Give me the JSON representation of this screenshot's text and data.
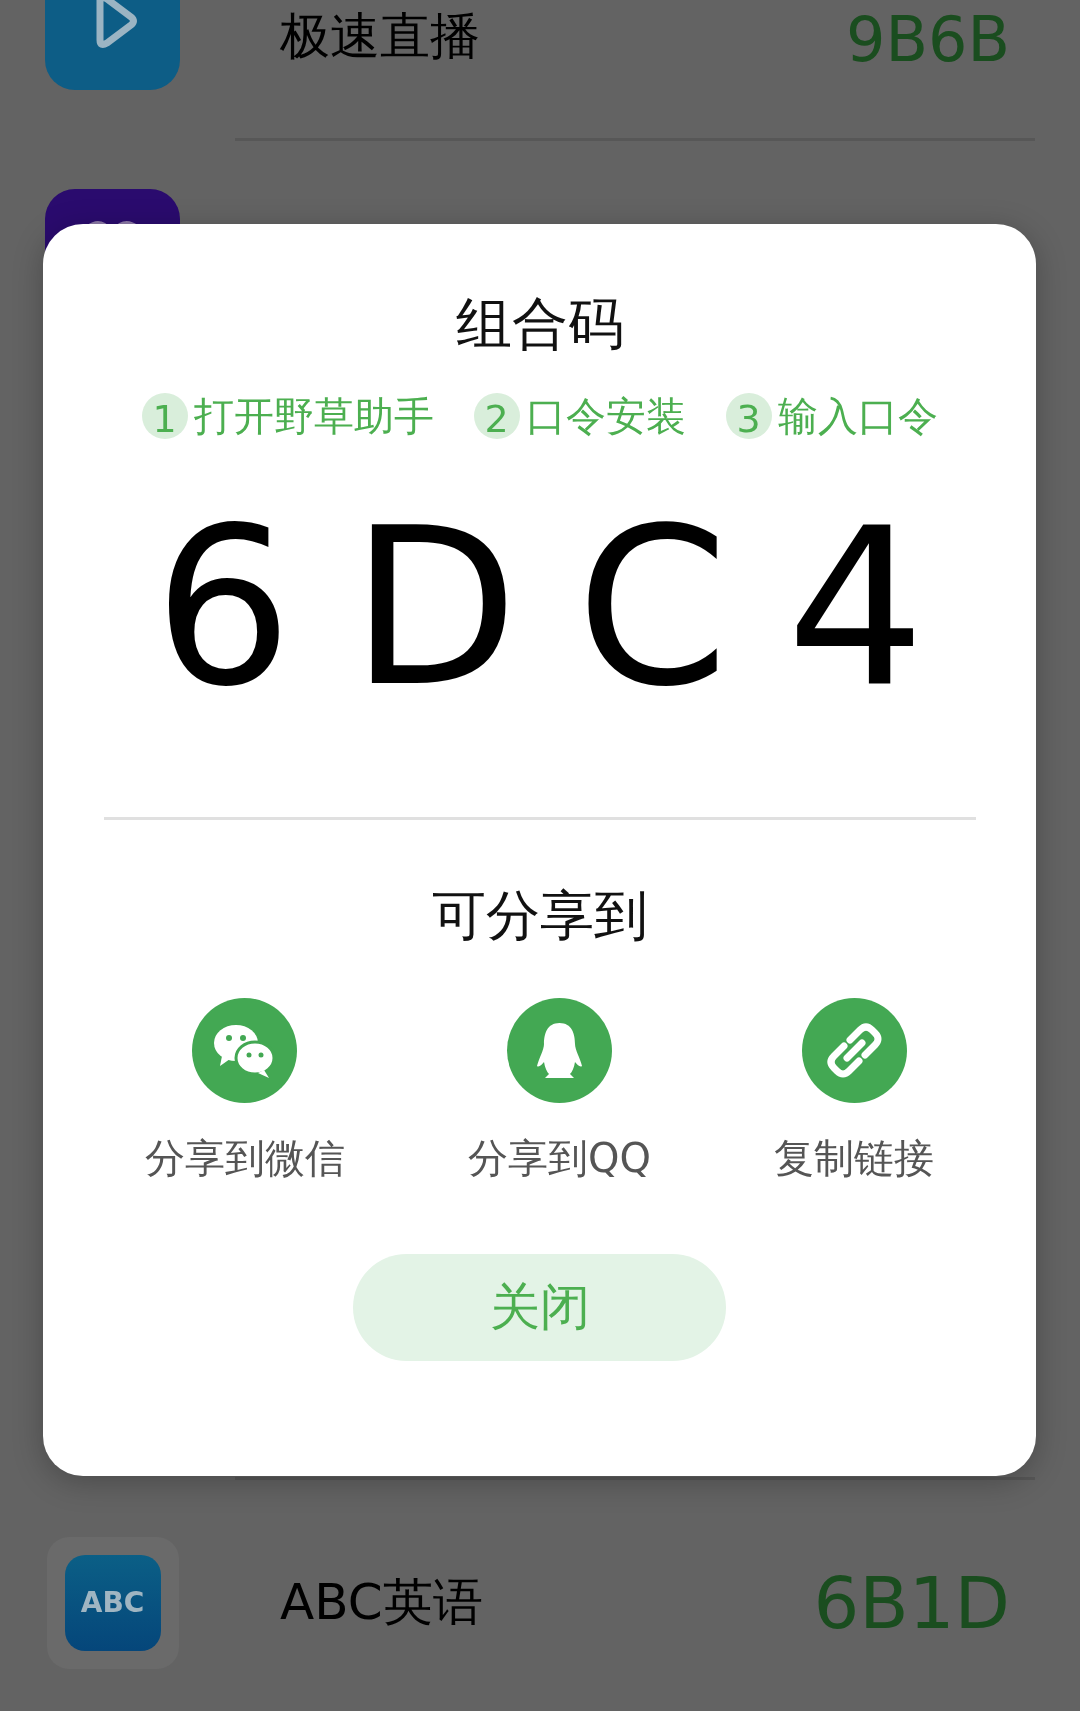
{
  "background_list": {
    "top_rows": [
      {
        "kind": "play",
        "name": "极速直播",
        "code": "9B6B"
      },
      {
        "kind": "dragon"
      }
    ],
    "bottom_rows": [
      {
        "kind": "abc",
        "icon_text": "ABC",
        "name": "ABC英语",
        "code": "6B1D"
      }
    ]
  },
  "dialog": {
    "title": "组合码",
    "steps": [
      {
        "number": "1",
        "label": "打开野草助手"
      },
      {
        "number": "2",
        "label": "口令安装"
      },
      {
        "number": "3",
        "label": "输入口令"
      }
    ],
    "code": "6DC4",
    "share_title": "可分享到",
    "share_options": [
      {
        "kind": "wechat",
        "label": "分享到微信"
      },
      {
        "kind": "qq",
        "label": "分享到QQ"
      },
      {
        "kind": "link",
        "label": "复制链接"
      }
    ],
    "close_button": "关闭"
  }
}
